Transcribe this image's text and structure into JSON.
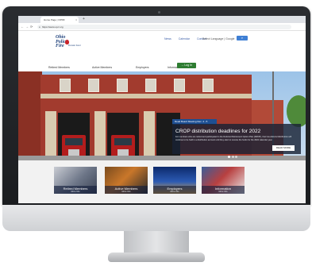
{
  "browser": {
    "tab_title": "Home Page | OPRF",
    "tab_close": "×",
    "new_tab": "+",
    "url": "https://www.op-f.org",
    "back": "←",
    "forward": "→",
    "reload": "⟳",
    "lock": "🔒"
  },
  "header": {
    "logo_line1": "Ohio",
    "logo_line2": "Police",
    "logo_line3": "Fire",
    "logo_sub": "Pension Fund",
    "util_nav": [
      "News",
      "Calendar",
      "Contact"
    ],
    "translate": "Select Language | Google",
    "search_label": "⌕",
    "main_nav": [
      "Retired Members",
      "Active Members",
      "Employers",
      "Information"
    ],
    "login": "→ Log In"
  },
  "hero": {
    "ribbon": "Read Board Meeting Dec. 4 - 5",
    "title": "CROP distribution deadlines for 2022",
    "body": "For members who are retired and participated in the Deferred Retirement Option Plan (DROP), their tax-deferral distribution will continue to be held in a distribution account until they elect to receive the funds for the 2022 calendar year.",
    "read_more": "READ MORE",
    "slides": 3
  },
  "tiles": [
    {
      "label": "Retired Members",
      "sub": "More Info"
    },
    {
      "label": "Active Members",
      "sub": "More Info"
    },
    {
      "label": "Employers",
      "sub": "More Info"
    },
    {
      "label": "Information",
      "sub": "More Info"
    }
  ]
}
